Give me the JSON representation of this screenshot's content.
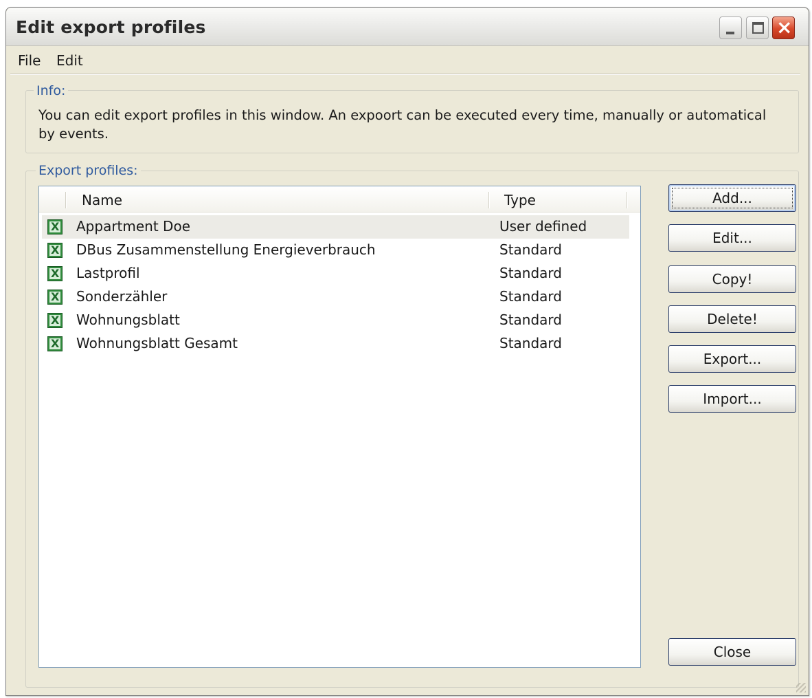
{
  "window": {
    "title": "Edit export profiles",
    "controls": {
      "minimize": "minimize",
      "maximize": "maximize",
      "close": "close"
    }
  },
  "menu": {
    "file": "File",
    "edit": "Edit"
  },
  "info": {
    "label": "Info:",
    "text": "You can edit export profiles in this window.  An expoort can be executed every time, manually or automatical by events."
  },
  "profiles": {
    "label": "Export profiles:",
    "columns": {
      "name": "Name",
      "type": "Type"
    },
    "rows": [
      {
        "name": "Appartment Doe",
        "type": "User defined",
        "icon": "excel-icon",
        "selected": true
      },
      {
        "name": "DBus Zusammenstellung Energieverbrauch",
        "type": "Standard",
        "icon": "excel-icon"
      },
      {
        "name": "Lastprofil",
        "type": "Standard",
        "icon": "excel-icon"
      },
      {
        "name": "Sonderzähler",
        "type": "Standard",
        "icon": "excel-icon"
      },
      {
        "name": "Wohnungsblatt",
        "type": "Standard",
        "icon": "excel-icon"
      },
      {
        "name": "Wohnungsblatt Gesamt",
        "type": "Standard",
        "icon": "excel-icon"
      }
    ]
  },
  "buttons": {
    "add": "Add...",
    "edit": "Edit...",
    "copy": "Copy!",
    "delete": "Delete!",
    "export": "Export...",
    "import": "Import...",
    "close": "Close"
  },
  "colors": {
    "window_bg": "#ece9d8",
    "group_label": "#2f5a9e",
    "selection": "#ecebe6",
    "excel_green": "#2f8a3c"
  }
}
